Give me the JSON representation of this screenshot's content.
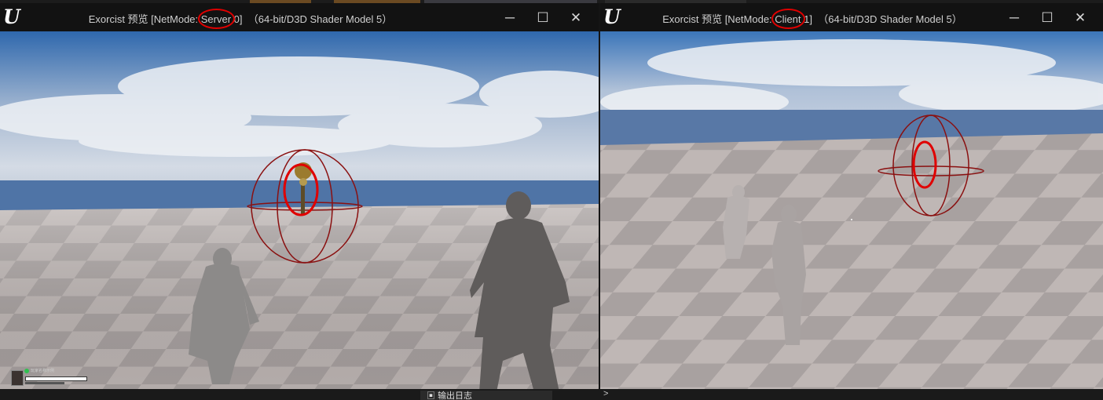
{
  "server_window": {
    "title_prefix": "Exorcist 预览 [NetMode: ",
    "netmode": "Server",
    "title_suffix": " 0]  （64-bit/D3D Shader Model 5）",
    "minimize": "─",
    "maximize": "☐",
    "close": "✕",
    "logo_glyph": "U",
    "annotation_color": "#e00000",
    "bounds_color": "#8a1010"
  },
  "client_window": {
    "title_prefix": "Exorcist 预览 [NetMode: ",
    "netmode": "Client",
    "title_suffix": " 1]  （64-bit/D3D Shader Model 5）",
    "minimize": "─",
    "maximize": "☐",
    "close": "✕",
    "logo_glyph": "U"
  },
  "hud": {
    "player_name": "玩家名称示例"
  },
  "footer": {
    "output_log_tab": "输出日志",
    "console_prompt": ">"
  },
  "scene_colors": {
    "sky_top": "#3a6fb0",
    "sky_mid": "#c9d4e3",
    "floor_light": "#c2bab8",
    "floor_dark": "#a29c9b",
    "horizon": "#5a78a8"
  }
}
